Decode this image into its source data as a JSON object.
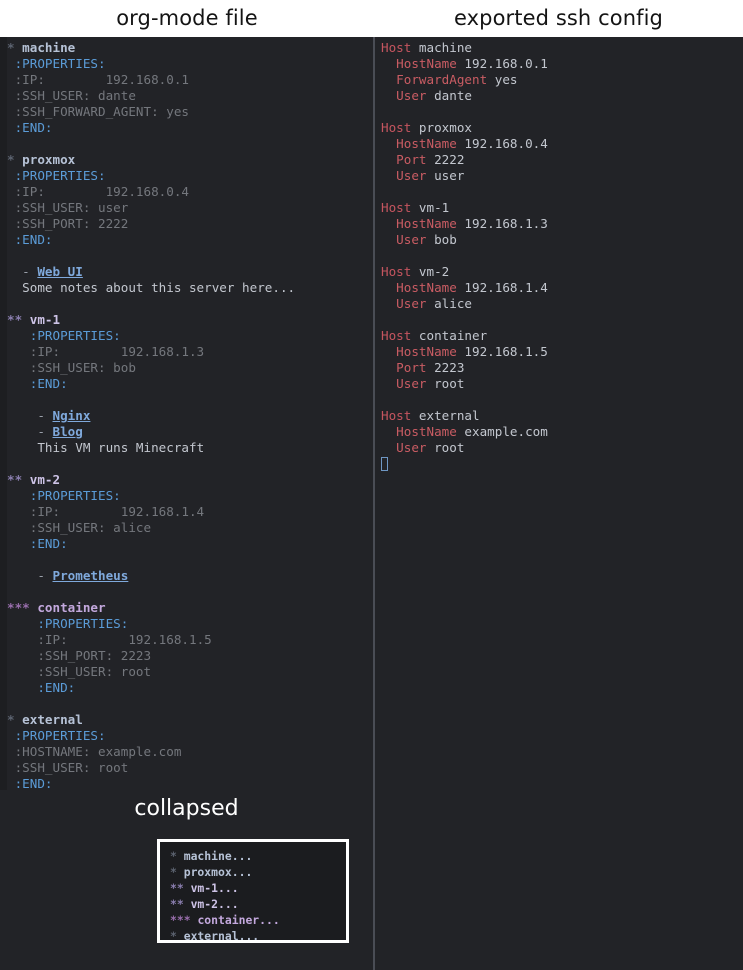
{
  "panels": {
    "left_title": "org-mode file",
    "right_title": "exported ssh config"
  },
  "org_file": {
    "lines": [
      {
        "kind": "heading",
        "level": 1,
        "stars": "*",
        "title": "machine"
      },
      {
        "kind": "drawer",
        "indent": 1,
        "text": ":PROPERTIES:"
      },
      {
        "kind": "prop",
        "indent": 1,
        "text": ":IP:        192.168.0.1"
      },
      {
        "kind": "prop",
        "indent": 1,
        "text": ":SSH_USER: dante"
      },
      {
        "kind": "prop",
        "indent": 1,
        "text": ":SSH_FORWARD_AGENT: yes"
      },
      {
        "kind": "drawer",
        "indent": 1,
        "text": ":END:"
      },
      {
        "kind": "blank"
      },
      {
        "kind": "heading",
        "level": 1,
        "stars": "*",
        "title": "proxmox"
      },
      {
        "kind": "drawer",
        "indent": 1,
        "text": ":PROPERTIES:"
      },
      {
        "kind": "prop",
        "indent": 1,
        "text": ":IP:        192.168.0.4"
      },
      {
        "kind": "prop",
        "indent": 1,
        "text": ":SSH_USER: user"
      },
      {
        "kind": "prop",
        "indent": 1,
        "text": ":SSH_PORT: 2222"
      },
      {
        "kind": "drawer",
        "indent": 1,
        "text": ":END:"
      },
      {
        "kind": "blank"
      },
      {
        "kind": "link",
        "indent": 1,
        "bullet": "-",
        "label": "Web UI"
      },
      {
        "kind": "plain",
        "indent": 1,
        "text": "Some notes about this server here..."
      },
      {
        "kind": "blank"
      },
      {
        "kind": "heading",
        "level": 2,
        "stars": "**",
        "title": "vm-1"
      },
      {
        "kind": "drawer",
        "indent": 2,
        "text": ":PROPERTIES:"
      },
      {
        "kind": "prop",
        "indent": 2,
        "text": ":IP:        192.168.1.3"
      },
      {
        "kind": "prop",
        "indent": 2,
        "text": ":SSH_USER: bob"
      },
      {
        "kind": "drawer",
        "indent": 2,
        "text": ":END:"
      },
      {
        "kind": "blank"
      },
      {
        "kind": "link",
        "indent": 2,
        "bullet": "-",
        "label": "Nginx"
      },
      {
        "kind": "link",
        "indent": 2,
        "bullet": "-",
        "label": "Blog"
      },
      {
        "kind": "plain",
        "indent": 2,
        "text": "This VM runs Minecraft"
      },
      {
        "kind": "blank"
      },
      {
        "kind": "heading",
        "level": 2,
        "stars": "**",
        "title": "vm-2"
      },
      {
        "kind": "drawer",
        "indent": 2,
        "text": ":PROPERTIES:"
      },
      {
        "kind": "prop",
        "indent": 2,
        "text": ":IP:        192.168.1.4"
      },
      {
        "kind": "prop",
        "indent": 2,
        "text": ":SSH_USER: alice"
      },
      {
        "kind": "drawer",
        "indent": 2,
        "text": ":END:"
      },
      {
        "kind": "blank"
      },
      {
        "kind": "link",
        "indent": 2,
        "bullet": "-",
        "label": "Prometheus"
      },
      {
        "kind": "blank"
      },
      {
        "kind": "heading",
        "level": 3,
        "stars": "***",
        "title": "container"
      },
      {
        "kind": "drawer",
        "indent": 3,
        "text": ":PROPERTIES:"
      },
      {
        "kind": "prop",
        "indent": 3,
        "text": ":IP:        192.168.1.5"
      },
      {
        "kind": "prop",
        "indent": 3,
        "text": ":SSH_PORT: 2223"
      },
      {
        "kind": "prop",
        "indent": 3,
        "text": ":SSH_USER: root"
      },
      {
        "kind": "drawer",
        "indent": 3,
        "text": ":END:"
      },
      {
        "kind": "blank"
      },
      {
        "kind": "heading",
        "level": 1,
        "stars": "*",
        "title": "external"
      },
      {
        "kind": "drawer",
        "indent": 1,
        "text": ":PROPERTIES:"
      },
      {
        "kind": "prop",
        "indent": 1,
        "text": ":HOSTNAME: example.com"
      },
      {
        "kind": "prop",
        "indent": 1,
        "text": ":SSH_USER: root"
      },
      {
        "kind": "drawer",
        "indent": 1,
        "text": ":END:"
      },
      {
        "kind": "cursor-block"
      }
    ]
  },
  "ssh_config": {
    "entries": [
      {
        "host_keyword": "Host",
        "host": "machine",
        "options": [
          {
            "key": "HostName",
            "value": "192.168.0.1"
          },
          {
            "key": "ForwardAgent",
            "value": "yes"
          },
          {
            "key": "User",
            "value": "dante"
          }
        ]
      },
      {
        "host_keyword": "Host",
        "host": "proxmox",
        "options": [
          {
            "key": "HostName",
            "value": "192.168.0.4"
          },
          {
            "key": "Port",
            "value": "2222"
          },
          {
            "key": "User",
            "value": "user"
          }
        ]
      },
      {
        "host_keyword": "Host",
        "host": "vm-1",
        "options": [
          {
            "key": "HostName",
            "value": "192.168.1.3"
          },
          {
            "key": "User",
            "value": "bob"
          }
        ]
      },
      {
        "host_keyword": "Host",
        "host": "vm-2",
        "options": [
          {
            "key": "HostName",
            "value": "192.168.1.4"
          },
          {
            "key": "User",
            "value": "alice"
          }
        ]
      },
      {
        "host_keyword": "Host",
        "host": "container",
        "options": [
          {
            "key": "HostName",
            "value": "192.168.1.5"
          },
          {
            "key": "Port",
            "value": "2223"
          },
          {
            "key": "User",
            "value": "root"
          }
        ]
      },
      {
        "host_keyword": "Host",
        "host": "external",
        "options": [
          {
            "key": "HostName",
            "value": "example.com"
          },
          {
            "key": "User",
            "value": "root"
          }
        ]
      }
    ]
  },
  "collapsed": {
    "title": "collapsed",
    "lines": [
      {
        "stars": "*",
        "level": 1,
        "title": "machine..."
      },
      {
        "stars": "*",
        "level": 1,
        "title": "proxmox..."
      },
      {
        "stars": "**",
        "level": 2,
        "title": "vm-1..."
      },
      {
        "stars": "**",
        "level": 2,
        "title": "vm-2..."
      },
      {
        "stars": "***",
        "level": 3,
        "title": "container..."
      },
      {
        "stars": "*",
        "level": 1,
        "title": "external..."
      }
    ]
  },
  "colors": {
    "editor_background": "#222327",
    "fringe": "#1d1e21",
    "divider": "#4a4d55",
    "header_background": "#ffffff",
    "header_text": "#141414",
    "org_level1_heading": "#b6c2d6",
    "org_level2_heading": "#cdc3e6",
    "org_level3_heading": "#c3a8dd",
    "org_drawer": "#5b9cd8",
    "org_property": "#74777d",
    "org_link": "#7fa9dc",
    "org_text": "#c3c7cf",
    "ssh_keyword": "#c5555f",
    "ssh_value": "#c3c7cf",
    "cursor": "#7c8fa8",
    "collapsed_border": "#ffffff"
  }
}
